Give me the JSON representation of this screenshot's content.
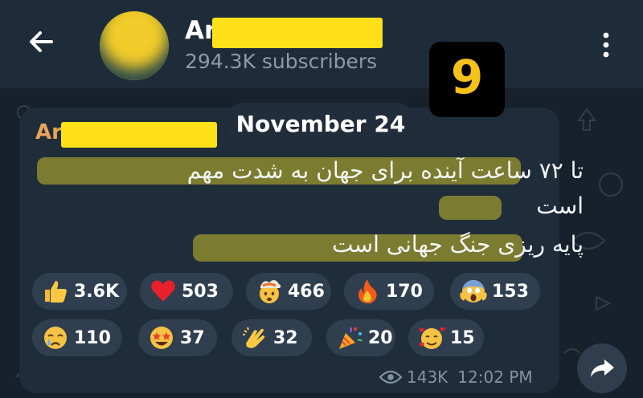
{
  "header": {
    "channel_name_prefix": "Ar",
    "subscribers": "294.3K subscribers"
  },
  "badge": {
    "number": "9"
  },
  "date_separator": "November 24",
  "message": {
    "sender_prefix": "Ar",
    "lines": [
      "تا ۷۲ ساعت آینده برای جهان به شدت مهم",
      "است",
      "پایه ریزی جنگ جهانی است"
    ],
    "views": "143K",
    "time": "12:02 PM"
  },
  "reactions": [
    {
      "icon": "thumbs-up-icon",
      "count": "3.6K"
    },
    {
      "icon": "red-heart-icon",
      "count": "503"
    },
    {
      "icon": "exploding-head-icon",
      "count": "466"
    },
    {
      "icon": "fire-icon",
      "count": "170"
    },
    {
      "icon": "screaming-face-icon",
      "count": "153"
    },
    {
      "icon": "crying-face-icon",
      "count": "110"
    },
    {
      "icon": "star-struck-icon",
      "count": "37"
    },
    {
      "icon": "clapping-hands-icon",
      "count": "32"
    },
    {
      "icon": "party-popper-icon",
      "count": "20"
    },
    {
      "icon": "smiling-face-with-hearts-icon",
      "count": "15"
    }
  ],
  "colors": {
    "header_bg": "#1e2c3a",
    "bubble_bg": "#1f2d3b",
    "sender_name": "#e7a55b",
    "redaction": "#ffe11a",
    "badge_digit": "#f6c118"
  }
}
